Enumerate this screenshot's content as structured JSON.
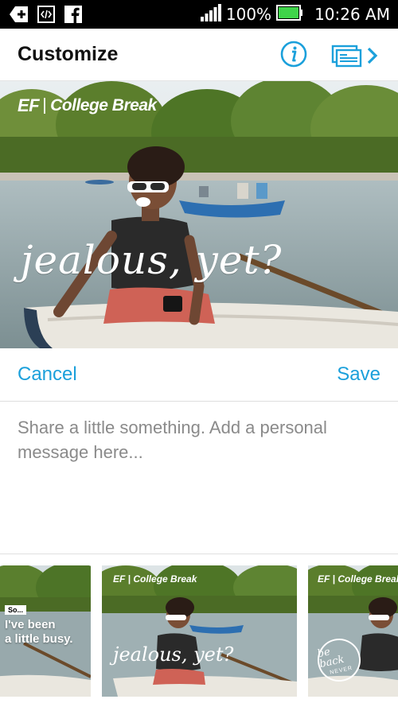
{
  "status_bar": {
    "battery": "100%",
    "time": "10:26 AM",
    "icons": [
      "add-icon",
      "code-icon",
      "facebook-icon",
      "signal-icon",
      "battery-icon"
    ],
    "battery_color": "#3fd44a"
  },
  "header": {
    "title": "Customize",
    "icons": [
      "info-icon",
      "cards-next-icon"
    ],
    "accent_color": "#1ba0db"
  },
  "hero": {
    "brand_mark": "EF",
    "brand_name": "College Break",
    "caption": "jealous, yet?"
  },
  "actions": {
    "cancel_label": "Cancel",
    "save_label": "Save"
  },
  "message": {
    "placeholder": "Share a little something. Add a personal message here..."
  },
  "thumbnails": [
    {
      "tag": "So...",
      "caption_line1": "I've been",
      "caption_line2": "a little busy."
    },
    {
      "brand_mark": "EF",
      "brand_name": "College Break",
      "caption": "jealous, yet?"
    },
    {
      "brand_mark": "EF",
      "brand_name": "College Break",
      "stamp_line1": "be back",
      "stamp_line2": "NEVER"
    }
  ]
}
